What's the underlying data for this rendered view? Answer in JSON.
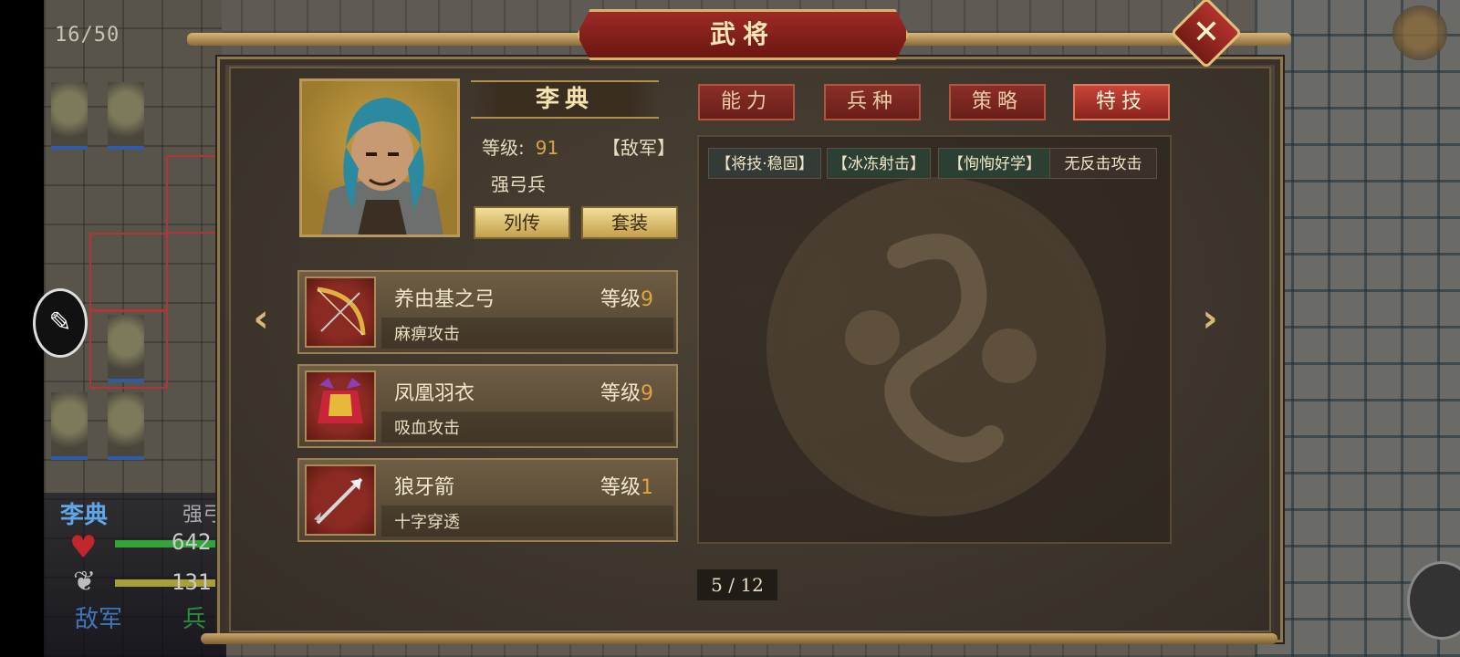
{
  "hud": {
    "turn_counter": "16/50",
    "unit_name": "李典",
    "unit_type": "强弓",
    "hp": "642",
    "mp": "131",
    "faction": "敌军",
    "extra": "兵"
  },
  "dialog": {
    "title": "武将",
    "close_icon": "✕",
    "general": {
      "name": "李典",
      "level_label": "等级:",
      "level_value": "91",
      "faction": "【敌军】",
      "troop_type": "强弓兵",
      "biography_button": "列传",
      "set_button": "套装"
    },
    "equipment": [
      {
        "name": "养由基之弓",
        "level_label": "等级",
        "level": "9",
        "effect": "麻痹攻击",
        "icon": "bow-icon"
      },
      {
        "name": "凤凰羽衣",
        "level_label": "等级",
        "level": "9",
        "effect": "吸血攻击",
        "icon": "armor-icon"
      },
      {
        "name": "狼牙箭",
        "level_label": "等级",
        "level": "1",
        "effect": "十字穿透",
        "icon": "arrow-icon"
      }
    ],
    "tabs": [
      {
        "label": "能力",
        "active": false
      },
      {
        "label": "兵种",
        "active": false
      },
      {
        "label": "策略",
        "active": false
      },
      {
        "label": "特技",
        "active": true
      }
    ],
    "skills": [
      "【将技·稳固】",
      "【冰冻射击】",
      "【恂恂好学】",
      "无反击攻击"
    ],
    "page": "5 / 12",
    "prev_arrow": "‹",
    "next_arrow": "›"
  },
  "colors": {
    "accent_gold": "#d8b878",
    "tab_red": "#8a2f28",
    "level_orange": "#e0a33e"
  }
}
